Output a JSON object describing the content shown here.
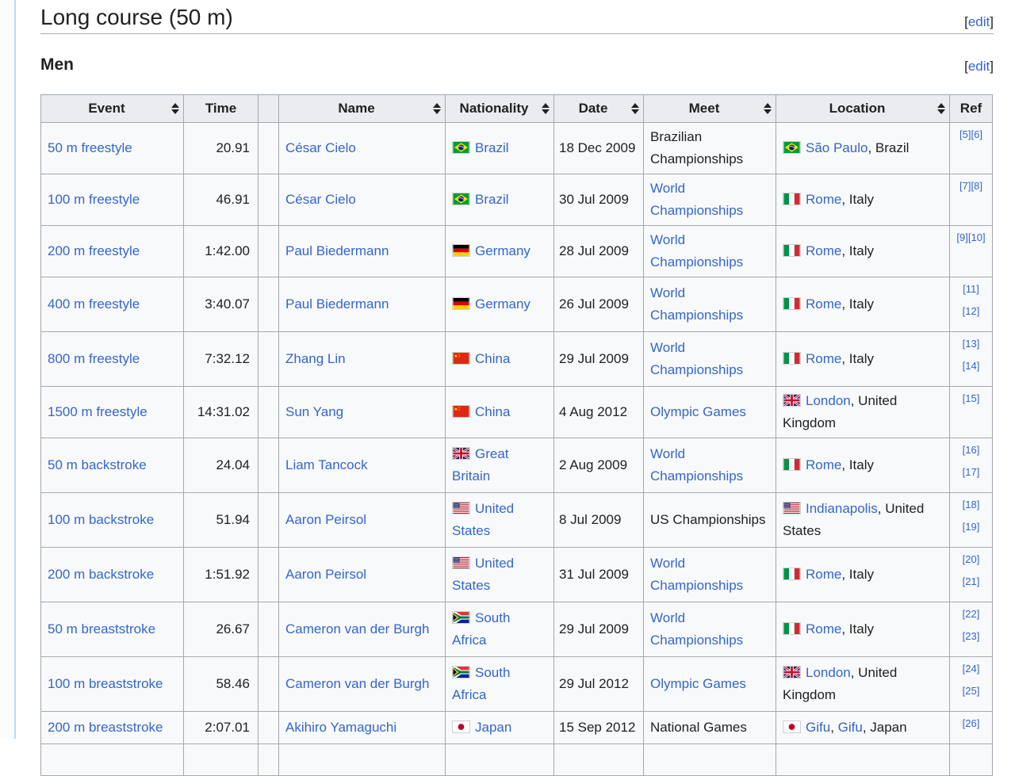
{
  "colors": {
    "link": "#3366cc",
    "header_bg": "#eaecf0",
    "row_bg": "#f8f9fa",
    "border": "#a2a9b1"
  },
  "page": {
    "section_title": "Long course (50 m)",
    "subsection_title": "Men",
    "edit": {
      "open": "[",
      "label": "edit",
      "close": "]"
    }
  },
  "table": {
    "headers": [
      {
        "label": "Event",
        "sortable": true
      },
      {
        "label": "Time",
        "sortable": false
      },
      {
        "label": "",
        "sortable": false
      },
      {
        "label": "Name",
        "sortable": true
      },
      {
        "label": "Nationality",
        "sortable": true
      },
      {
        "label": "Date",
        "sortable": true
      },
      {
        "label": "Meet",
        "sortable": true
      },
      {
        "label": "Location",
        "sortable": true
      },
      {
        "label": "Ref",
        "sortable": false
      }
    ],
    "rows": [
      {
        "event": "50 m freestyle",
        "time": "20.91",
        "name": "César Cielo",
        "nationality": {
          "flag": "BR",
          "label": "Brazil"
        },
        "date": "18 Dec 2009",
        "meet": {
          "label": "Brazilian Championships",
          "link": false
        },
        "location": {
          "flag": "BR",
          "links": [
            "São Paulo"
          ],
          "suffix": ", Brazil"
        },
        "refs": [
          "[5]",
          "[6]"
        ]
      },
      {
        "event": "100 m freestyle",
        "time": "46.91",
        "name": "César Cielo",
        "nationality": {
          "flag": "BR",
          "label": "Brazil"
        },
        "date": "30 Jul 2009",
        "meet": {
          "label": "World Championships",
          "link": true
        },
        "location": {
          "flag": "IT",
          "links": [
            "Rome"
          ],
          "suffix": ", Italy"
        },
        "refs": [
          "[7]",
          "[8]"
        ]
      },
      {
        "event": "200 m freestyle",
        "time": "1:42.00",
        "name": "Paul Biedermann",
        "nationality": {
          "flag": "DE",
          "label": "Germany"
        },
        "date": "28 Jul 2009",
        "meet": {
          "label": "World Championships",
          "link": true
        },
        "location": {
          "flag": "IT",
          "links": [
            "Rome"
          ],
          "suffix": ", Italy"
        },
        "refs": [
          "[9]",
          "[10]"
        ]
      },
      {
        "event": "400 m freestyle",
        "time": "3:40.07",
        "name": "Paul Biedermann",
        "nationality": {
          "flag": "DE",
          "label": "Germany"
        },
        "date": "26 Jul 2009",
        "meet": {
          "label": "World Championships",
          "link": true
        },
        "location": {
          "flag": "IT",
          "links": [
            "Rome"
          ],
          "suffix": ", Italy"
        },
        "refs": [
          "[11]",
          "[12]"
        ]
      },
      {
        "event": "800 m freestyle",
        "time": "7:32.12",
        "name": "Zhang Lin",
        "nationality": {
          "flag": "CN",
          "label": "China"
        },
        "date": "29 Jul 2009",
        "meet": {
          "label": "World Championships",
          "link": true
        },
        "location": {
          "flag": "IT",
          "links": [
            "Rome"
          ],
          "suffix": ", Italy"
        },
        "refs": [
          "[13]",
          "[14]"
        ]
      },
      {
        "event": "1500 m freestyle",
        "time": "14:31.02",
        "name": "Sun Yang",
        "nationality": {
          "flag": "CN",
          "label": "China"
        },
        "date": "4 Aug 2012",
        "meet": {
          "label": "Olympic Games",
          "link": true
        },
        "location": {
          "flag": "GB",
          "links": [
            "London"
          ],
          "suffix": ", United Kingdom"
        },
        "refs": [
          "[15]"
        ]
      },
      {
        "event": "50 m backstroke",
        "time": "24.04",
        "name": "Liam Tancock",
        "nationality": {
          "flag": "GB",
          "label": "Great Britain"
        },
        "date": "2 Aug 2009",
        "meet": {
          "label": "World Championships",
          "link": true
        },
        "location": {
          "flag": "IT",
          "links": [
            "Rome"
          ],
          "suffix": ", Italy"
        },
        "refs": [
          "[16]",
          "[17]"
        ]
      },
      {
        "event": "100 m backstroke",
        "time": "51.94",
        "name": "Aaron Peirsol",
        "nationality": {
          "flag": "US",
          "label": "United States"
        },
        "date": "8 Jul 2009",
        "meet": {
          "label": "US Championships",
          "link": false
        },
        "location": {
          "flag": "US",
          "links": [
            "Indianapolis"
          ],
          "suffix": ", United States"
        },
        "refs": [
          "[18]",
          "[19]"
        ]
      },
      {
        "event": "200 m backstroke",
        "time": "1:51.92",
        "name": "Aaron Peirsol",
        "nationality": {
          "flag": "US",
          "label": "United States"
        },
        "date": "31 Jul 2009",
        "meet": {
          "label": "World Championships",
          "link": true
        },
        "location": {
          "flag": "IT",
          "links": [
            "Rome"
          ],
          "suffix": ", Italy"
        },
        "refs": [
          "[20]",
          "[21]"
        ]
      },
      {
        "event": "50 m breaststroke",
        "time": "26.67",
        "name": "Cameron van der Burgh",
        "nationality": {
          "flag": "ZA",
          "label": "South Africa"
        },
        "date": "29 Jul 2009",
        "meet": {
          "label": "World Championships",
          "link": true
        },
        "location": {
          "flag": "IT",
          "links": [
            "Rome"
          ],
          "suffix": ", Italy"
        },
        "refs": [
          "[22]",
          "[23]"
        ]
      },
      {
        "event": "100 m breaststroke",
        "time": "58.46",
        "name": "Cameron van der Burgh",
        "nationality": {
          "flag": "ZA",
          "label": "South Africa"
        },
        "date": "29 Jul 2012",
        "meet": {
          "label": "Olympic Games",
          "link": true
        },
        "location": {
          "flag": "GB",
          "links": [
            "London"
          ],
          "suffix": ", United Kingdom"
        },
        "refs": [
          "[24]",
          "[25]"
        ]
      },
      {
        "event": "200 m breaststroke",
        "time": "2:07.01",
        "name": "Akihiro Yamaguchi",
        "nationality": {
          "flag": "JP",
          "label": "Japan"
        },
        "date": "15 Sep 2012",
        "meet": {
          "label": "National Games",
          "link": false
        },
        "location": {
          "flag": "JP",
          "links": [
            "Gifu",
            "Gifu"
          ],
          "suffix": ", Japan"
        },
        "refs": [
          "[26]"
        ]
      }
    ]
  }
}
